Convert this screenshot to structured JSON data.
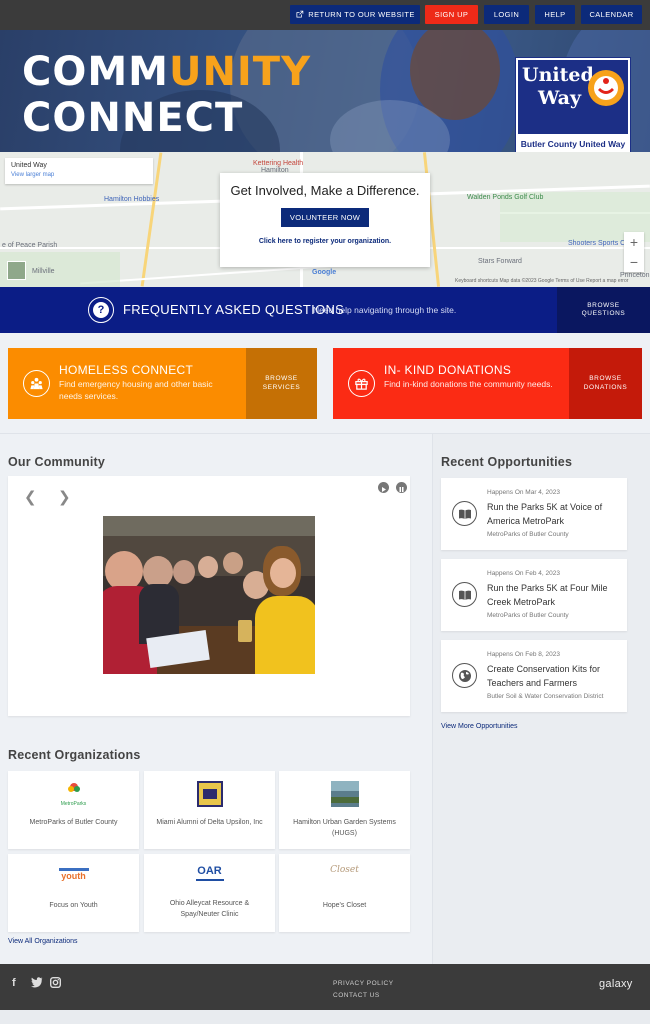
{
  "topbar": {
    "return": "RETURN TO OUR WEBSITE",
    "signup": "SIGN UP",
    "login": "LOGIN",
    "help": "HELP",
    "calendar": "CALENDAR"
  },
  "hero": {
    "line1_a": "COMM",
    "line1_b": "UNITY",
    "line2": "CONNECT",
    "logo_word1": "United",
    "logo_word2": "Way",
    "logo_footer": "Butler County United Way"
  },
  "map": {
    "info_title": "United Way",
    "info_link": "View larger map",
    "labels": {
      "kettering": "Kettering Health",
      "hamilton": "Hamilton",
      "hobbies": "Hamilton Hobbies",
      "walden": "Walden Ponds Golf Club",
      "peace": "e of Peace Parish",
      "millville": "Millville",
      "stars": "Stars Forward",
      "shoolers": "Shooters Sports C",
      "princeton": "Princeton",
      "google": "Google"
    },
    "footer": "Keyboard shortcuts   Map data ©2023 Google   Terms of Use   Report a map error"
  },
  "cta": {
    "heading": "Get Involved, Make a Difference.",
    "button": "VOLUNTEER NOW",
    "register": "Click here to register your organization."
  },
  "faq": {
    "title": "FREQUENTLY ASKED QUESTIONS",
    "subtitle": "Need help navigating through the site.",
    "browse_line1": "BROWSE",
    "browse_line2": "QUESTIONS"
  },
  "services": [
    {
      "title": "HOMELESS CONNECT",
      "desc": "Find emergency housing and other basic needs services.",
      "browse_line1": "BROWSE",
      "browse_line2": "SERVICES"
    },
    {
      "title": "IN- KIND DONATIONS",
      "desc": "Find in-kind donations the community needs.",
      "browse_line1": "BROWSE",
      "browse_line2": "DONATIONS"
    }
  ],
  "community": {
    "title": "Our Community"
  },
  "opportunities": {
    "title": "Recent Opportunities",
    "items": [
      {
        "date": "Happens On Mar 4, 2023",
        "title": "Run the Parks 5K at Voice of America MetroPark",
        "org": "MetroParks of Butler County"
      },
      {
        "date": "Happens On Feb 4, 2023",
        "title": "Run the Parks 5K at Four Mile Creek MetroPark",
        "org": "MetroParks of Butler County"
      },
      {
        "date": "Happens On Feb 8, 2023",
        "title": "Create Conservation Kits for Teachers and Farmers",
        "org": "Butler Soil & Water Conservation District"
      }
    ],
    "view_more": "View More Opportunities"
  },
  "organizations": {
    "title": "Recent Organizations",
    "items": [
      {
        "name": "MetroParks of Butler County"
      },
      {
        "name": "Miami Alumni of Delta Upsilon, Inc"
      },
      {
        "name": "Hamilton Urban Garden Systems (HUGS)"
      },
      {
        "name": "Focus on Youth"
      },
      {
        "name": "Ohio Alleycat Resource & Spay/Neuter Clinic"
      },
      {
        "name": "Hope's Closet"
      }
    ],
    "view_all": "View All Organizations",
    "logo_text": {
      "metroparks": "MetroParks",
      "focus": "youth",
      "oar": "OAR",
      "hope": "Closet"
    }
  },
  "footer": {
    "privacy": "PRIVACY POLICY",
    "contact": "CONTACT US",
    "brand": "galaxy"
  },
  "colors": {
    "navy": "#0c2a7a",
    "red": "#ee2a18",
    "orange": "#fb8c00",
    "faq_blue": "#0b1d86"
  }
}
